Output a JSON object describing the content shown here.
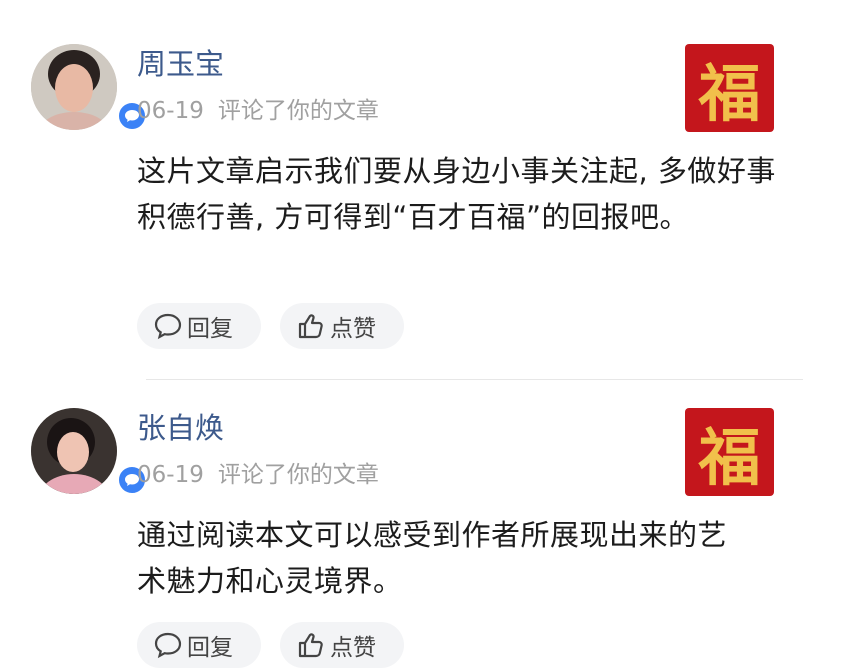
{
  "comments": [
    {
      "name": "周玉宝",
      "date": "06-19",
      "action": "评论了你的文章",
      "text": "这片文章启示我们要从身边小事关注起, 多做好事积德行善, 方可得到“百才百福”的回报吧。",
      "thumb_char": "福",
      "reply_label": "回复",
      "like_label": "点赞"
    },
    {
      "name": "张自焕",
      "date": "06-19",
      "action": "评论了你的文章",
      "text": "通过阅读本文可以感受到作者所展现出来的艺术魅力和心灵境界。",
      "thumb_char": "福",
      "reply_label": "回复",
      "like_label": "点赞"
    }
  ],
  "colors": {
    "name": "#3d5a8c",
    "meta": "#a0a0a0",
    "badge": "#3b82f6",
    "thumb_bg": "#c4161c",
    "thumb_char": "#f1c04b",
    "pill_bg": "#f3f4f6"
  },
  "icons": [
    "comment-bubble-icon",
    "thumbs-up-icon",
    "chat-badge-icon"
  ]
}
